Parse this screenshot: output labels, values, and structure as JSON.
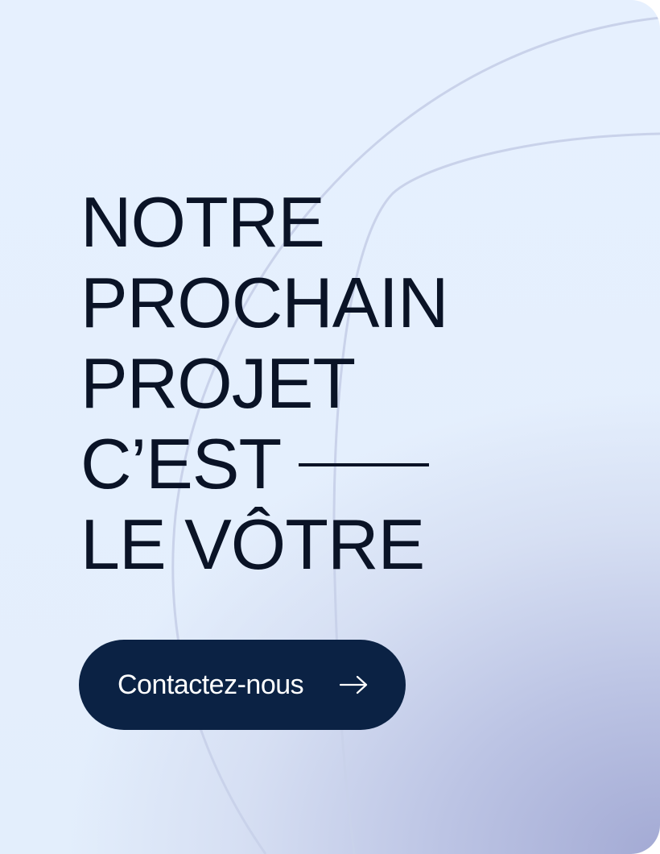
{
  "hero": {
    "headline_lines": [
      "NOTRE",
      "PROCHAIN",
      "PROJET",
      "C’EST",
      "LE VÔTRE"
    ]
  },
  "cta": {
    "label": "Contactez-nous",
    "icon": "arrow-right-icon"
  },
  "colors": {
    "background_top": "#e6f0fe",
    "background_corner": "#a3aad4",
    "text": "#0a1326",
    "button": "#0b2244",
    "button_text": "#ffffff",
    "decor_lines": "#c9d2ea"
  }
}
